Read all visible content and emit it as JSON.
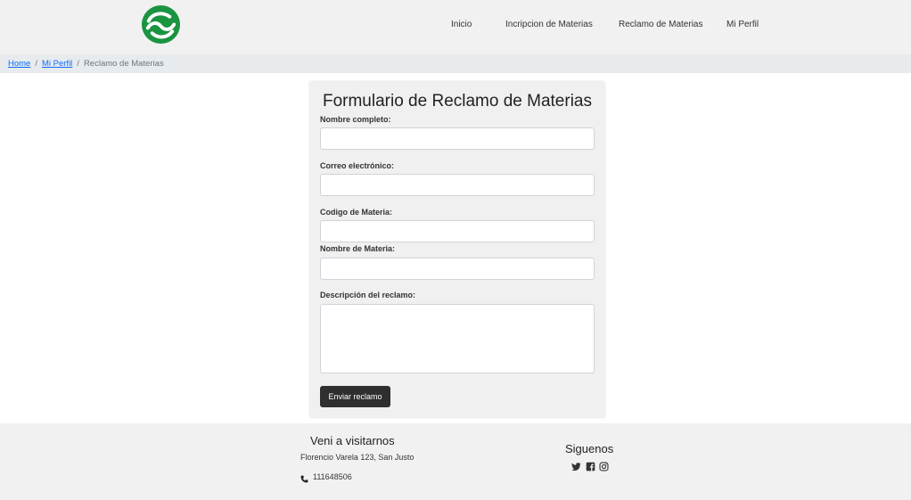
{
  "header": {
    "nav": [
      "Inicio",
      "Incripcion de Materias",
      "Reclamo de Materias",
      "Mi Perfil"
    ]
  },
  "breadcrumb": {
    "home": "Home",
    "profile": "Mi Perfil",
    "current": "Reclamo de Materias",
    "separator": "/"
  },
  "form": {
    "title": "Formulario de Reclamo de Materias",
    "fields": [
      {
        "label": "Nombre completo:",
        "value": ""
      },
      {
        "label": "Correo electrónico:",
        "value": ""
      },
      {
        "label": "Codigo de Materia:",
        "value": ""
      },
      {
        "label": "Nombre de Materia:",
        "value": ""
      },
      {
        "label": "Descripción del reclamo:",
        "value": ""
      }
    ],
    "submit_label": "Enviar reclamo"
  },
  "footer": {
    "visit_title": "Veni a visitarnos",
    "address": "Florencio Varela 123, San Justo",
    "phone": "111648506",
    "social_title": "Siguenos",
    "social_icons": [
      "twitter-icon",
      "facebook-icon",
      "instagram-icon"
    ]
  },
  "colors": {
    "brand_green": "#1a9440",
    "link_blue": "#0d6efd",
    "button_dark": "#2f2f2f",
    "header_bg": "#f1f1f1"
  }
}
